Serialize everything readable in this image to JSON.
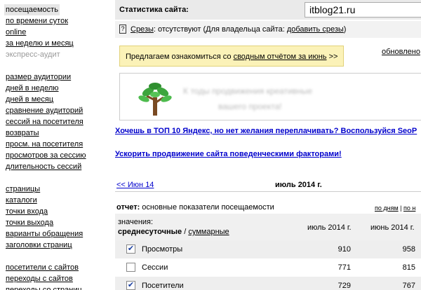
{
  "sidebar": {
    "group1": [
      {
        "label": "посещаемость",
        "state": "active"
      },
      {
        "label": "по времени суток",
        "state": "link"
      },
      {
        "label": "online",
        "state": "link"
      },
      {
        "label": "за неделю и месяц",
        "state": "link"
      },
      {
        "label": "экспресс-аудит",
        "state": "disabled"
      }
    ],
    "group2": [
      {
        "label": "размер аудитории"
      },
      {
        "label": "дней в неделю"
      },
      {
        "label": "дней в месяц"
      },
      {
        "label": "сравнение аудиторий"
      },
      {
        "label": "сессий на посетителя"
      },
      {
        "label": "возвраты"
      },
      {
        "label": "просм. на посетителя"
      },
      {
        "label": "просмотров за сессию"
      },
      {
        "label": "длительность сессий"
      }
    ],
    "group3": [
      {
        "label": "страницы"
      },
      {
        "label": "каталоги"
      },
      {
        "label": "точки входа"
      },
      {
        "label": "точки выхода"
      },
      {
        "label": "варианты обращения"
      },
      {
        "label": "заголовки страниц"
      }
    ],
    "group4": [
      {
        "label": "посетители с сайтов"
      },
      {
        "label": "переходы с сайтов"
      },
      {
        "label": "переходы со страниц"
      }
    ]
  },
  "topbar": {
    "label": "Статистика сайта:",
    "site_value": "itblog21.ru"
  },
  "slices": {
    "icon": "question-icon",
    "link": "Срезы",
    "text": ": отсутствуют (Для владельца сайта: ",
    "add_link": "добавить срезы",
    "close": ")"
  },
  "notice": {
    "prefix": "Предлагаем ознакомиться со ",
    "link": "сводным отчётом за июнь",
    "suffix": " >>"
  },
  "updated": "обновлено",
  "banner": {
    "icon": "tree-icon",
    "blur_line1": "К            тоды продвижения креативные",
    "blur_line2": "           вашего проекта!"
  },
  "promos": {
    "line1": "Хочешь в ТОП 10 Яндекс, но нет желания переплачивать? Воспользуйся SeoP",
    "line2": "Ускорить продвижение сайта поведенческими факторами!"
  },
  "nav": {
    "prev": "<< Июн 14",
    "current": "июль 2014 г."
  },
  "report": {
    "label": "отчет:",
    "title": " основные показатели посещаемости",
    "by_days": "по дням",
    "sep": " | ",
    "by_weeks": "по н"
  },
  "table": {
    "values_label": "значения:",
    "daily_label": "среднесуточные",
    "slash": " / ",
    "total_label": "суммарные",
    "col1": "июль 2014 г.",
    "col2": "июнь 2014 г.",
    "rows": [
      {
        "label": "Просмотры",
        "checked": true,
        "v1": "910",
        "v2": "958"
      },
      {
        "label": "Сессии",
        "checked": false,
        "v1": "771",
        "v2": "815"
      },
      {
        "label": "Посетители",
        "checked": true,
        "v1": "729",
        "v2": "767"
      }
    ]
  },
  "colors": {
    "link": "#0000cc",
    "notice_bg": "#fbf2b8",
    "topbar_bg": "#eaeaea"
  }
}
